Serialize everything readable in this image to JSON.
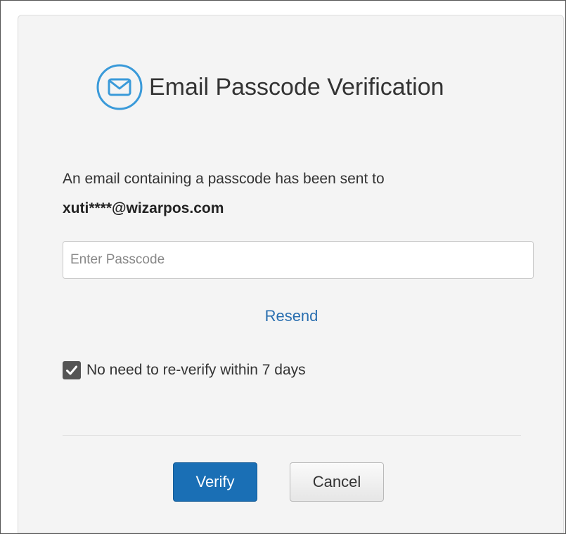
{
  "dialog": {
    "title": "Email Passcode Verification",
    "icon": "envelope-circle-icon",
    "message_line1": "An email containing a passcode has been sent to",
    "email": "xuti****@wizarpos.com"
  },
  "passcode": {
    "value": "",
    "placeholder": "Enter Passcode"
  },
  "resend_label": "Resend",
  "remember": {
    "checked": true,
    "label": "No need to re-verify within 7 days"
  },
  "actions": {
    "verify_label": "Verify",
    "cancel_label": "Cancel"
  },
  "colors": {
    "accent": "#1a6fb5",
    "icon": "#3a9ad9",
    "link": "#2a6fb0"
  }
}
